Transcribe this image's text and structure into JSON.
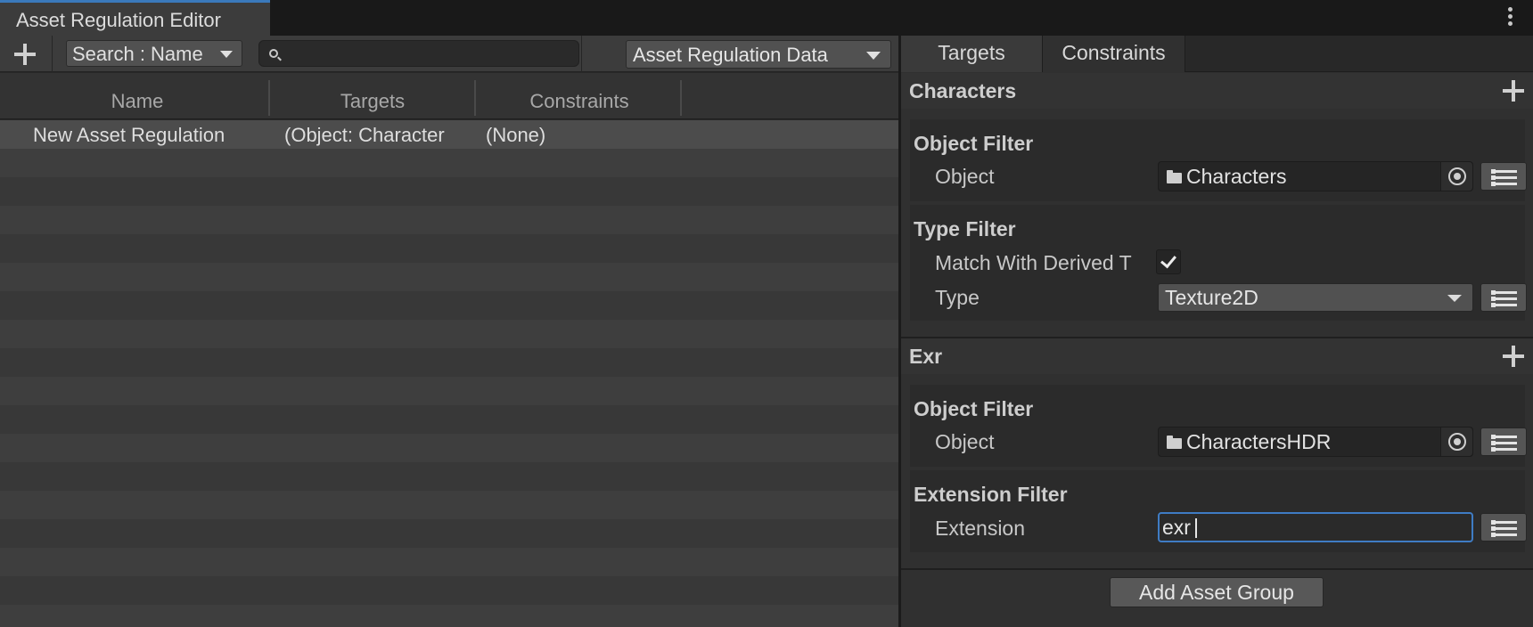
{
  "window": {
    "title": "Asset Regulation Editor"
  },
  "toolbar": {
    "search_mode": "Search : Name",
    "search_value": "",
    "data_select": "Asset Regulation Data"
  },
  "table": {
    "columns": [
      "Name",
      "Targets",
      "Constraints"
    ],
    "rows": [
      {
        "name": "New Asset Regulation",
        "targets": "(Object: Character",
        "constraints": "(None)"
      }
    ]
  },
  "right_panel": {
    "tabs": [
      "Targets",
      "Constraints"
    ],
    "active_tab": "Targets",
    "groups": [
      {
        "title": "Characters",
        "object_filter": {
          "title": "Object Filter",
          "label": "Object",
          "value": "Characters"
        },
        "type_filter": {
          "title": "Type Filter",
          "match_label": "Match With Derived T",
          "match_checked": true,
          "type_label": "Type",
          "type_value": "Texture2D"
        }
      },
      {
        "title": "Exr",
        "object_filter": {
          "title": "Object Filter",
          "label": "Object",
          "value": "CharactersHDR"
        },
        "extension_filter": {
          "title": "Extension Filter",
          "label": "Extension",
          "value": "exr"
        }
      }
    ],
    "add_group_label": "Add Asset Group"
  },
  "colors": {
    "accent": "#3a79bb",
    "focus_border": "#3f7cc4",
    "background": "#282828"
  }
}
